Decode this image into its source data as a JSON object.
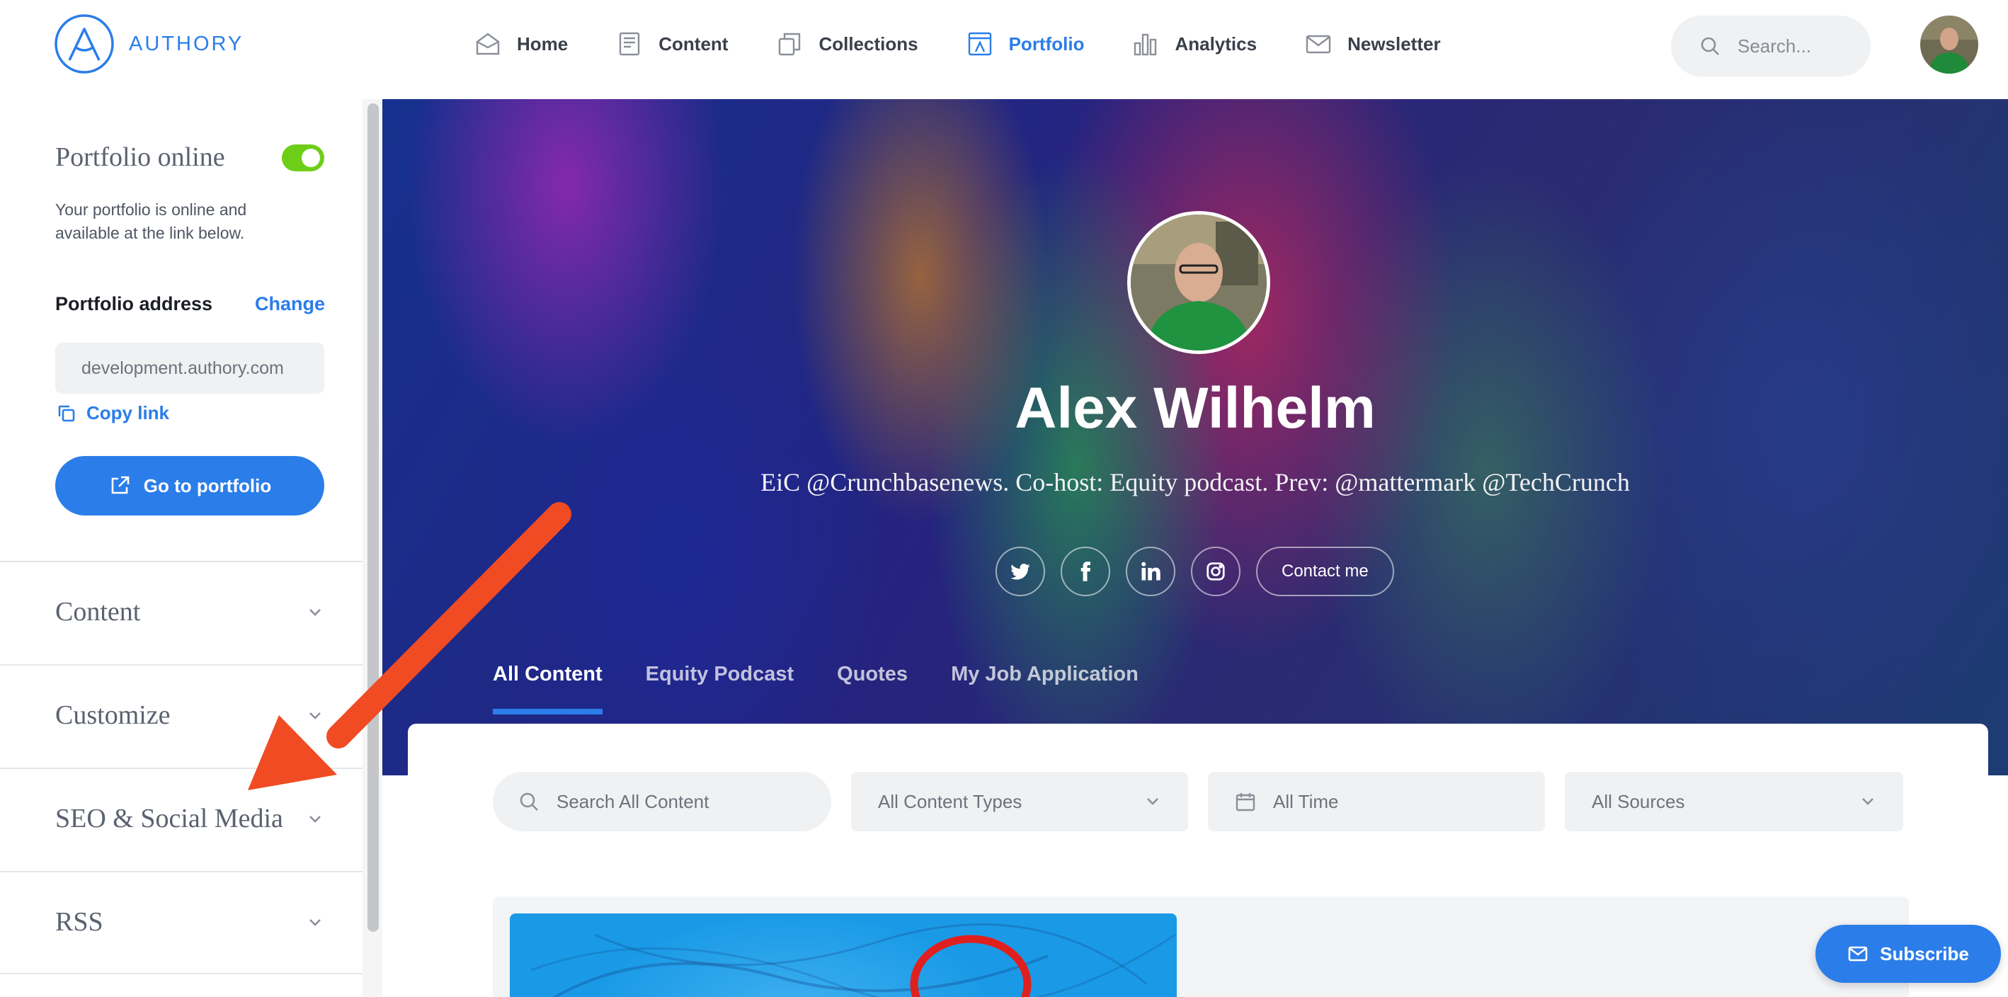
{
  "brand": {
    "name": "AUTHORY",
    "accent": "#2b7de9",
    "toggle_on": "#6ece17",
    "annotation_arrow": "#f04b23"
  },
  "nav": {
    "items": [
      {
        "label": "Home",
        "icon": "home-icon"
      },
      {
        "label": "Content",
        "icon": "document-icon"
      },
      {
        "label": "Collections",
        "icon": "collections-icon"
      },
      {
        "label": "Portfolio",
        "icon": "portfolio-icon",
        "active": true
      },
      {
        "label": "Analytics",
        "icon": "bar-chart-icon"
      },
      {
        "label": "Newsletter",
        "icon": "mail-icon"
      }
    ],
    "search_placeholder": "Search..."
  },
  "sidebar": {
    "portfolio_online_title": "Portfolio online",
    "portfolio_online_enabled": true,
    "portfolio_online_desc": "Your portfolio is online and available at the link below.",
    "address_label": "Portfolio address",
    "change_label": "Change",
    "address_value": "development.authory.com",
    "copy_link_label": "Copy link",
    "go_button_label": "Go to portfolio",
    "sections": [
      "Content",
      "Customize",
      "SEO & Social Media",
      "RSS"
    ]
  },
  "hero": {
    "name": "Alex Wilhelm",
    "bio": "EiC @Crunchbasenews. Co-host: Equity podcast. Prev: @mattermark @TechCrunch",
    "socials": [
      "twitter-icon",
      "facebook-icon",
      "linkedin-icon",
      "instagram-icon"
    ],
    "contact_label": "Contact me",
    "tabs": [
      "All Content",
      "Equity Podcast",
      "Quotes",
      "My Job Application"
    ],
    "active_tab": "All Content"
  },
  "filters": {
    "search_placeholder": "Search All Content",
    "content_types": "All Content Types",
    "time": "All Time",
    "sources": "All Sources"
  },
  "subscribe_label": "Subscribe"
}
